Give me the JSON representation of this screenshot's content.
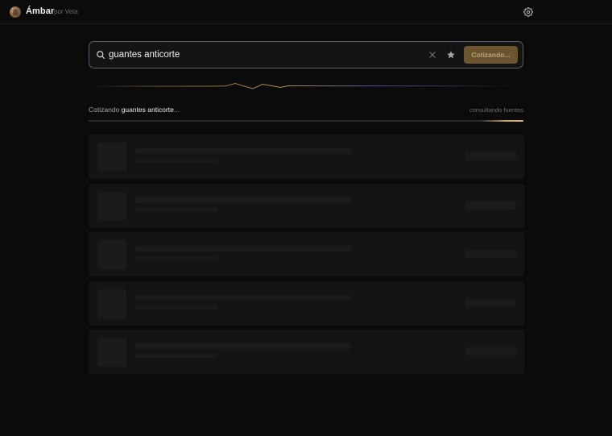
{
  "header": {
    "brand": "Ámbar",
    "byline": "por Veta"
  },
  "search": {
    "value": "guantes anticorte",
    "button_label": "Cotizando..."
  },
  "status": {
    "prefix": "Cotizando",
    "query": "guantes anticorte",
    "suffix": "...",
    "right_text": "consultando fuentes",
    "progress": 0.1
  },
  "colors": {
    "accent": "#c9a45c",
    "button_bg": "#6b5530",
    "background": "#0b0b0b",
    "card_bg": "#141414"
  },
  "icons": {
    "logo": "avatar-logo",
    "settings": "gear-icon",
    "search": "search-icon",
    "clear": "close-icon",
    "favorite": "star-icon"
  },
  "results": {
    "skeleton_count": 5
  }
}
